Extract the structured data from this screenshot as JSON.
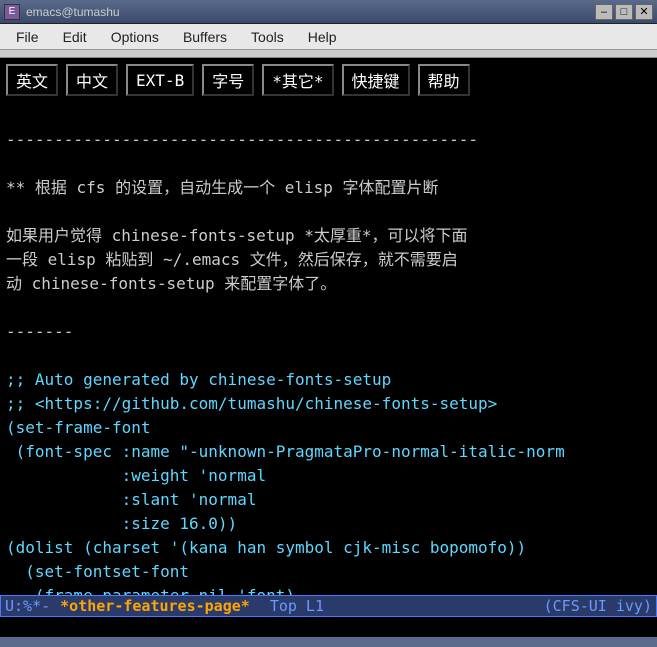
{
  "window": {
    "title": "emacs@tumashu",
    "icon_label": "E"
  },
  "menubar": {
    "items": [
      "File",
      "Edit",
      "Options",
      "Buffers",
      "Tools",
      "Help"
    ]
  },
  "buttons": {
    "items": [
      "英文",
      "中文",
      "EXT-B",
      "字号",
      "*其它*",
      "快捷键",
      "帮助"
    ]
  },
  "content": {
    "hr1": "-------------------------------------------------",
    "heading": "** 根据 cfs 的设置，自动生成一个 elisp 字体配置片断",
    "para1": "如果用户觉得 chinese-fonts-setup *太厚重*，可以将下面\n一段 elisp 粘贴到 ~/.emacs 文件，然后保存，就不需要启\n动 chinese-fonts-setup 来配置字体了。",
    "hr2": "-------",
    "code": ";; Auto generated by chinese-fonts-setup\n;; <https://github.com/tumashu/chinese-fonts-setup>\n(set-frame-font\n (font-spec :name \"-unknown-PragmataPro-normal-italic-norm\n            :weight 'normal\n            :slant 'normal\n            :size 16.0))\n(dolist (charset '(kana han symbol cjk-misc bopomofo))\n  (set-fontset-font\n   (frame-parameter nil 'font)"
  },
  "modeline": {
    "left": "U:%*-",
    "buffer": "*other-features-page*",
    "position": "Top L1",
    "mode": "(CFS-UI ivy)"
  }
}
